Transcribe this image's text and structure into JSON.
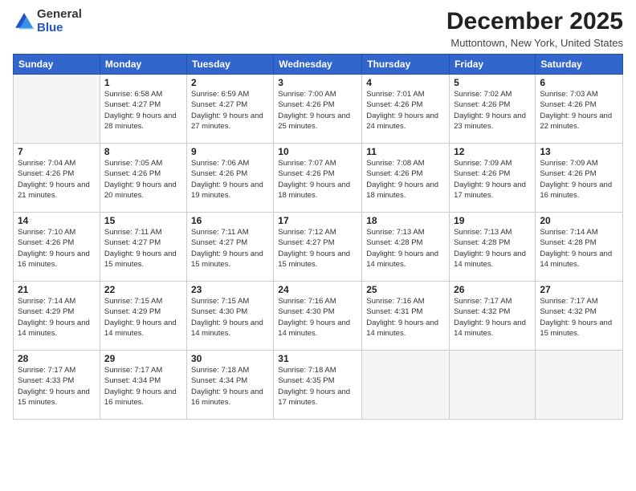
{
  "logo": {
    "general": "General",
    "blue": "Blue"
  },
  "header": {
    "title": "December 2025",
    "location": "Muttontown, New York, United States"
  },
  "weekdays": [
    "Sunday",
    "Monday",
    "Tuesday",
    "Wednesday",
    "Thursday",
    "Friday",
    "Saturday"
  ],
  "weeks": [
    [
      {
        "day": "",
        "empty": true
      },
      {
        "day": "1",
        "sunrise": "6:58 AM",
        "sunset": "4:27 PM",
        "daylight": "9 hours and 28 minutes."
      },
      {
        "day": "2",
        "sunrise": "6:59 AM",
        "sunset": "4:27 PM",
        "daylight": "9 hours and 27 minutes."
      },
      {
        "day": "3",
        "sunrise": "7:00 AM",
        "sunset": "4:26 PM",
        "daylight": "9 hours and 25 minutes."
      },
      {
        "day": "4",
        "sunrise": "7:01 AM",
        "sunset": "4:26 PM",
        "daylight": "9 hours and 24 minutes."
      },
      {
        "day": "5",
        "sunrise": "7:02 AM",
        "sunset": "4:26 PM",
        "daylight": "9 hours and 23 minutes."
      },
      {
        "day": "6",
        "sunrise": "7:03 AM",
        "sunset": "4:26 PM",
        "daylight": "9 hours and 22 minutes."
      }
    ],
    [
      {
        "day": "7",
        "sunrise": "7:04 AM",
        "sunset": "4:26 PM",
        "daylight": "9 hours and 21 minutes."
      },
      {
        "day": "8",
        "sunrise": "7:05 AM",
        "sunset": "4:26 PM",
        "daylight": "9 hours and 20 minutes."
      },
      {
        "day": "9",
        "sunrise": "7:06 AM",
        "sunset": "4:26 PM",
        "daylight": "9 hours and 19 minutes."
      },
      {
        "day": "10",
        "sunrise": "7:07 AM",
        "sunset": "4:26 PM",
        "daylight": "9 hours and 18 minutes."
      },
      {
        "day": "11",
        "sunrise": "7:08 AM",
        "sunset": "4:26 PM",
        "daylight": "9 hours and 18 minutes."
      },
      {
        "day": "12",
        "sunrise": "7:09 AM",
        "sunset": "4:26 PM",
        "daylight": "9 hours and 17 minutes."
      },
      {
        "day": "13",
        "sunrise": "7:09 AM",
        "sunset": "4:26 PM",
        "daylight": "9 hours and 16 minutes."
      }
    ],
    [
      {
        "day": "14",
        "sunrise": "7:10 AM",
        "sunset": "4:26 PM",
        "daylight": "9 hours and 16 minutes."
      },
      {
        "day": "15",
        "sunrise": "7:11 AM",
        "sunset": "4:27 PM",
        "daylight": "9 hours and 15 minutes."
      },
      {
        "day": "16",
        "sunrise": "7:11 AM",
        "sunset": "4:27 PM",
        "daylight": "9 hours and 15 minutes."
      },
      {
        "day": "17",
        "sunrise": "7:12 AM",
        "sunset": "4:27 PM",
        "daylight": "9 hours and 15 minutes."
      },
      {
        "day": "18",
        "sunrise": "7:13 AM",
        "sunset": "4:28 PM",
        "daylight": "9 hours and 14 minutes."
      },
      {
        "day": "19",
        "sunrise": "7:13 AM",
        "sunset": "4:28 PM",
        "daylight": "9 hours and 14 minutes."
      },
      {
        "day": "20",
        "sunrise": "7:14 AM",
        "sunset": "4:28 PM",
        "daylight": "9 hours and 14 minutes."
      }
    ],
    [
      {
        "day": "21",
        "sunrise": "7:14 AM",
        "sunset": "4:29 PM",
        "daylight": "9 hours and 14 minutes."
      },
      {
        "day": "22",
        "sunrise": "7:15 AM",
        "sunset": "4:29 PM",
        "daylight": "9 hours and 14 minutes."
      },
      {
        "day": "23",
        "sunrise": "7:15 AM",
        "sunset": "4:30 PM",
        "daylight": "9 hours and 14 minutes."
      },
      {
        "day": "24",
        "sunrise": "7:16 AM",
        "sunset": "4:30 PM",
        "daylight": "9 hours and 14 minutes."
      },
      {
        "day": "25",
        "sunrise": "7:16 AM",
        "sunset": "4:31 PM",
        "daylight": "9 hours and 14 minutes."
      },
      {
        "day": "26",
        "sunrise": "7:17 AM",
        "sunset": "4:32 PM",
        "daylight": "9 hours and 14 minutes."
      },
      {
        "day": "27",
        "sunrise": "7:17 AM",
        "sunset": "4:32 PM",
        "daylight": "9 hours and 15 minutes."
      }
    ],
    [
      {
        "day": "28",
        "sunrise": "7:17 AM",
        "sunset": "4:33 PM",
        "daylight": "9 hours and 15 minutes."
      },
      {
        "day": "29",
        "sunrise": "7:17 AM",
        "sunset": "4:34 PM",
        "daylight": "9 hours and 16 minutes."
      },
      {
        "day": "30",
        "sunrise": "7:18 AM",
        "sunset": "4:34 PM",
        "daylight": "9 hours and 16 minutes."
      },
      {
        "day": "31",
        "sunrise": "7:18 AM",
        "sunset": "4:35 PM",
        "daylight": "9 hours and 17 minutes."
      },
      {
        "day": "",
        "empty": true
      },
      {
        "day": "",
        "empty": true
      },
      {
        "day": "",
        "empty": true
      }
    ]
  ]
}
